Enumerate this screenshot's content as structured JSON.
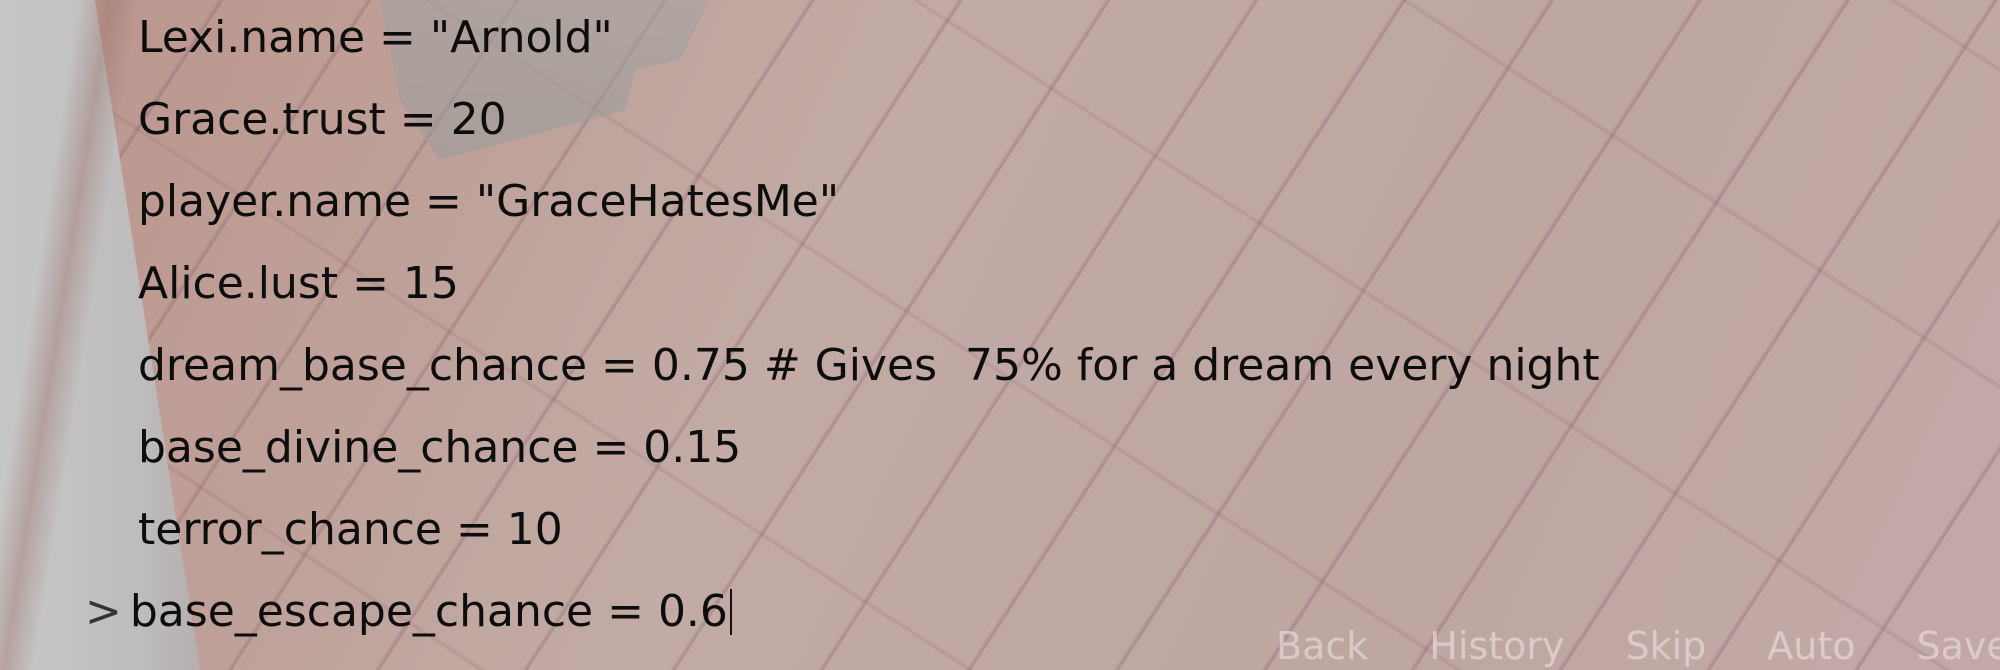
{
  "console": {
    "history": [
      "Lexi.name = \"Arnold\"",
      "Grace.trust = 20",
      "player.name = \"GraceHatesMe\"",
      "Alice.lust = 15",
      "dream_base_chance = 0.75 # Gives  75% for a dream every night",
      "base_divine_chance = 0.15",
      "terror_chance = 10"
    ],
    "prompt": ">",
    "input_value": "base_escape_chance = 0.6"
  },
  "quick_menu": {
    "items": [
      "Back",
      "History",
      "Skip",
      "Auto",
      "Save"
    ]
  }
}
